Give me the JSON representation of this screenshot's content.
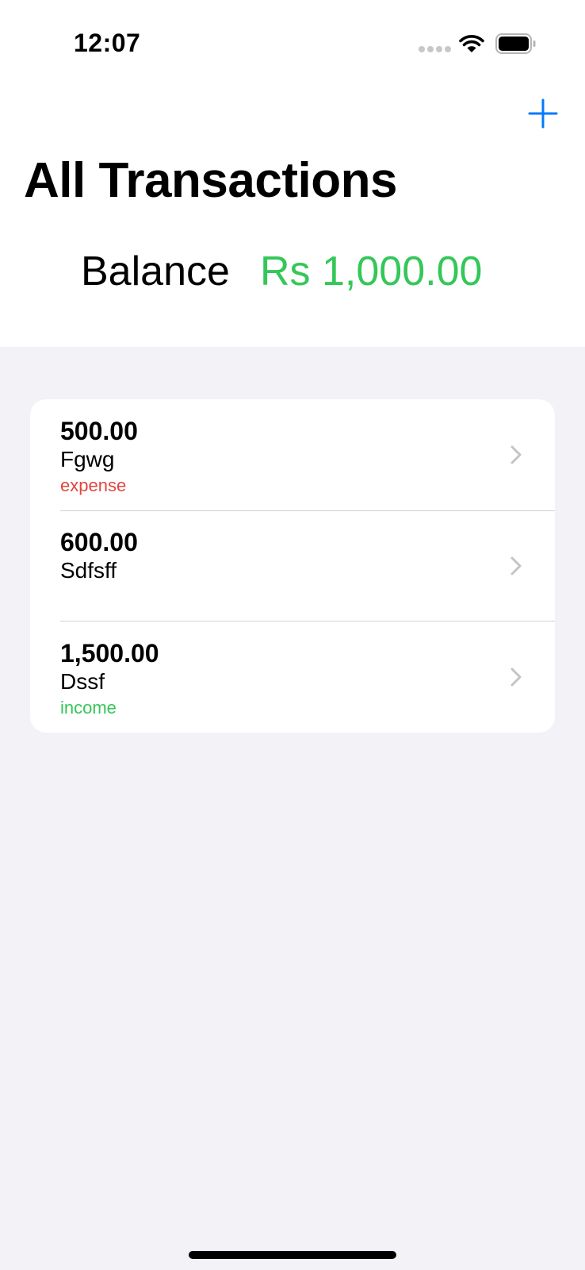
{
  "status_bar": {
    "time": "12:07"
  },
  "nav": {
    "add_icon": "plus-icon",
    "title": "All Transactions"
  },
  "balance": {
    "label": "Balance",
    "value": "Rs 1,000.00",
    "value_color": "#34c759"
  },
  "transactions": [
    {
      "amount": "500.00",
      "name": "Fgwg",
      "type": "expense",
      "type_color": "#e0463c"
    },
    {
      "amount": "600.00",
      "name": "Sdfsff",
      "type": ""
    },
    {
      "amount": "1,500.00",
      "name": "Dssf",
      "type": "income",
      "type_color": "#34c759"
    }
  ],
  "colors": {
    "accent": "#007aff",
    "background": "#f2f2f7",
    "expense": "#e0463c",
    "income": "#34c759",
    "chevron": "#c4c4c7"
  }
}
